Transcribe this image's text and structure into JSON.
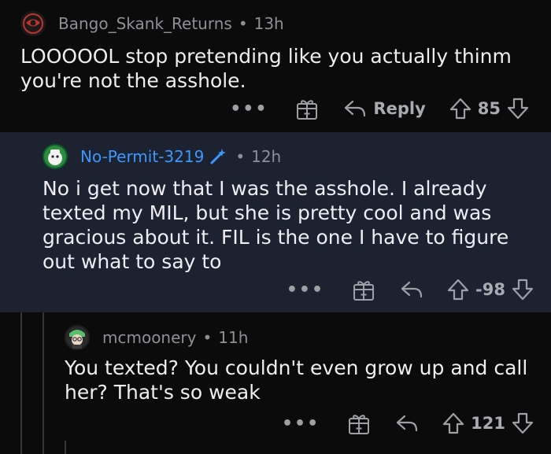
{
  "comments": [
    {
      "author": "Bango_Skank_Returns",
      "age": "13h",
      "body": "LOOOOOL stop pretending like you actually thinm you're not the asshole.",
      "reply_label": "Reply",
      "score": "85",
      "more": "•••"
    },
    {
      "author": "No-Permit-3219",
      "age": "12h",
      "body": "No i get now that I was the asshole. I already texted my MIL, but she is pretty cool and was gracious about it. FIL is the one I have to figure out what to say to",
      "score": "-98",
      "more": "•••"
    },
    {
      "author": "mcmoonery",
      "age": "11h",
      "body": "You texted? You couldn't even grow up and call her? That's so weak",
      "score": "121",
      "more": "•••"
    }
  ],
  "separator": "•",
  "colors": {
    "background": "#0b0b0b",
    "op_highlight": "#1c2230",
    "op_author": "#3c98ff",
    "meta_text": "#8d9196"
  },
  "icons": [
    "award-gift-icon",
    "reply-arrow-icon",
    "upvote-icon",
    "downvote-icon",
    "op-wand-icon",
    "avatar-icon"
  ]
}
